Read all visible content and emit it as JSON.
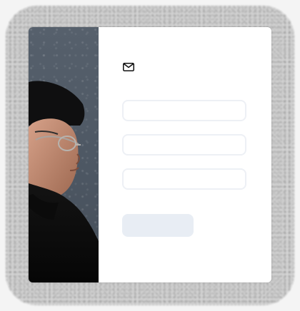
{
  "form": {
    "icon": "mail-icon",
    "fields": [
      {
        "value": "",
        "placeholder": ""
      },
      {
        "value": "",
        "placeholder": ""
      },
      {
        "value": "",
        "placeholder": ""
      }
    ],
    "submit_label": ""
  },
  "colors": {
    "card_bg": "#ffffff",
    "field_border": "#edf0f5",
    "button_bg": "#e8edf4",
    "photo_bg": "#4d5763"
  }
}
